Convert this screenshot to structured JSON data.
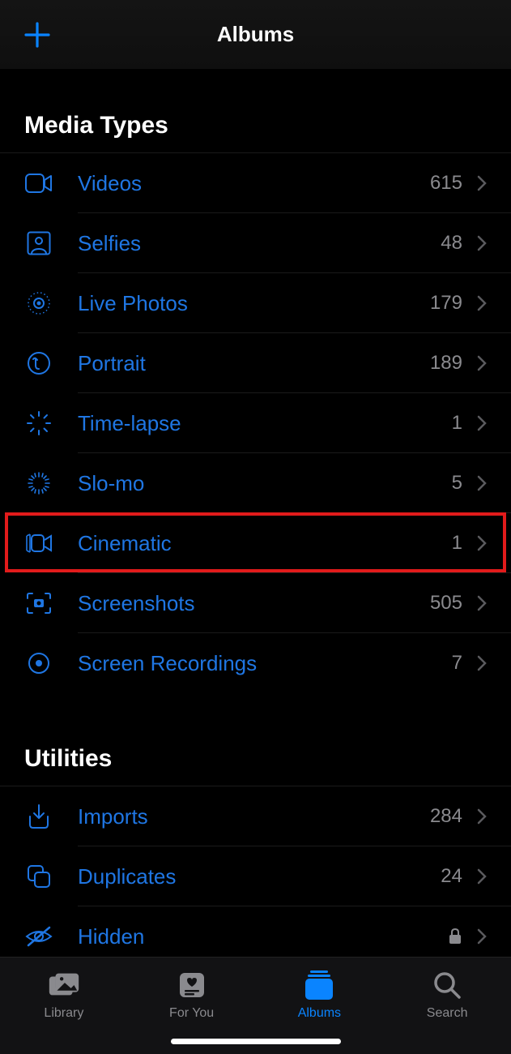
{
  "header": {
    "title": "Albums"
  },
  "sections": {
    "mediaTypes": {
      "title": "Media Types",
      "items": [
        {
          "label": "Videos",
          "count": "615",
          "icon": "video-icon"
        },
        {
          "label": "Selfies",
          "count": "48",
          "icon": "selfie-icon"
        },
        {
          "label": "Live Photos",
          "count": "179",
          "icon": "livephotos-icon"
        },
        {
          "label": "Portrait",
          "count": "189",
          "icon": "portrait-icon"
        },
        {
          "label": "Time-lapse",
          "count": "1",
          "icon": "timelapse-icon"
        },
        {
          "label": "Slo-mo",
          "count": "5",
          "icon": "slomo-icon"
        },
        {
          "label": "Cinematic",
          "count": "1",
          "icon": "cinematic-icon"
        },
        {
          "label": "Screenshots",
          "count": "505",
          "icon": "screenshots-icon"
        },
        {
          "label": "Screen Recordings",
          "count": "7",
          "icon": "screenrec-icon"
        }
      ]
    },
    "utilities": {
      "title": "Utilities",
      "items": [
        {
          "label": "Imports",
          "count": "284",
          "icon": "imports-icon"
        },
        {
          "label": "Duplicates",
          "count": "24",
          "icon": "duplicates-icon"
        },
        {
          "label": "Hidden",
          "count": "",
          "icon": "hidden-icon",
          "locked": true
        }
      ]
    }
  },
  "tabs": [
    {
      "label": "Library",
      "icon": "library-tab-icon",
      "active": false
    },
    {
      "label": "For You",
      "icon": "foryou-tab-icon",
      "active": false
    },
    {
      "label": "Albums",
      "icon": "albums-tab-icon",
      "active": true
    },
    {
      "label": "Search",
      "icon": "search-tab-icon",
      "active": false
    }
  ],
  "highlighted_row_index": 5
}
